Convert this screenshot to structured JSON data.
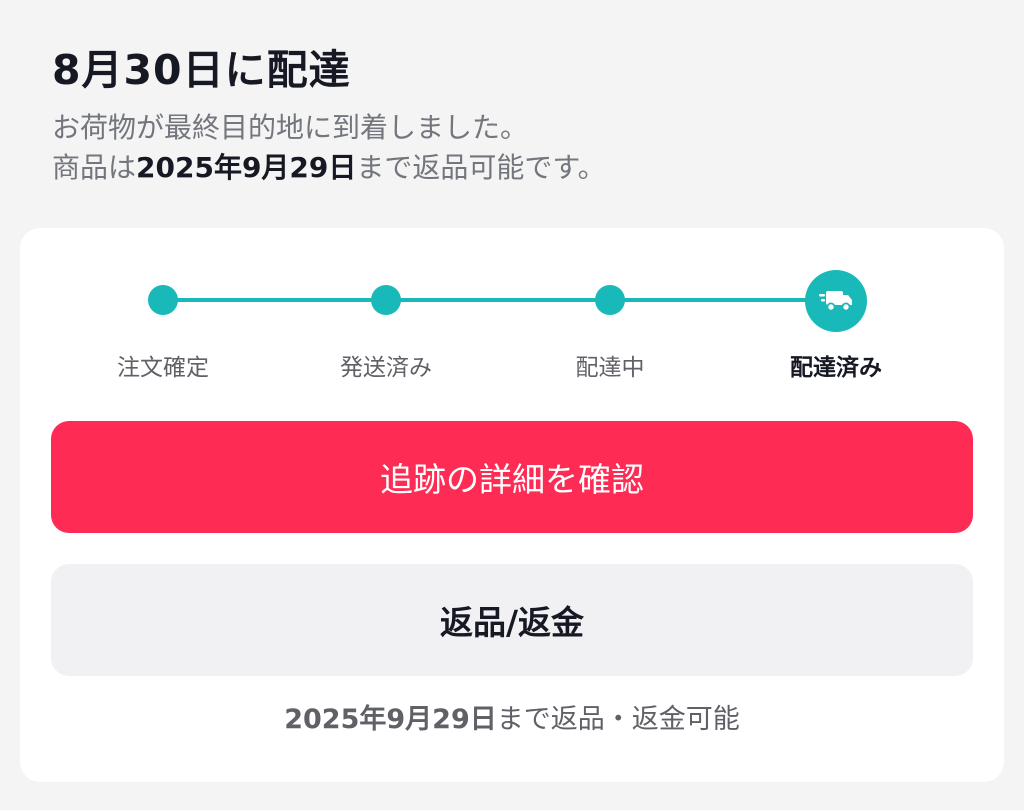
{
  "header": {
    "title": "8月30日に配達",
    "line1": "お荷物が最終目的地に到着しました。",
    "line2_prefix": "商品は",
    "line2_date": "2025年9月29日",
    "line2_suffix": "まで返品可能です。"
  },
  "tracker": {
    "steps": [
      {
        "label": "注文確定"
      },
      {
        "label": "発送済み"
      },
      {
        "label": "配達中"
      },
      {
        "label": "配達済み"
      }
    ],
    "current_step_icon": "delivery-truck-icon"
  },
  "actions": {
    "track_label": "追跡の詳細を確認",
    "return_label": "返品/返金"
  },
  "note": {
    "date": "2025年9月29日",
    "suffix": "まで返品・返金可能"
  },
  "colors": {
    "accent": "#19b9b9",
    "primary": "#fe2c55",
    "secondary_bg": "#f1f1f3",
    "text_dark": "#161823",
    "text_muted": "#73767d"
  }
}
